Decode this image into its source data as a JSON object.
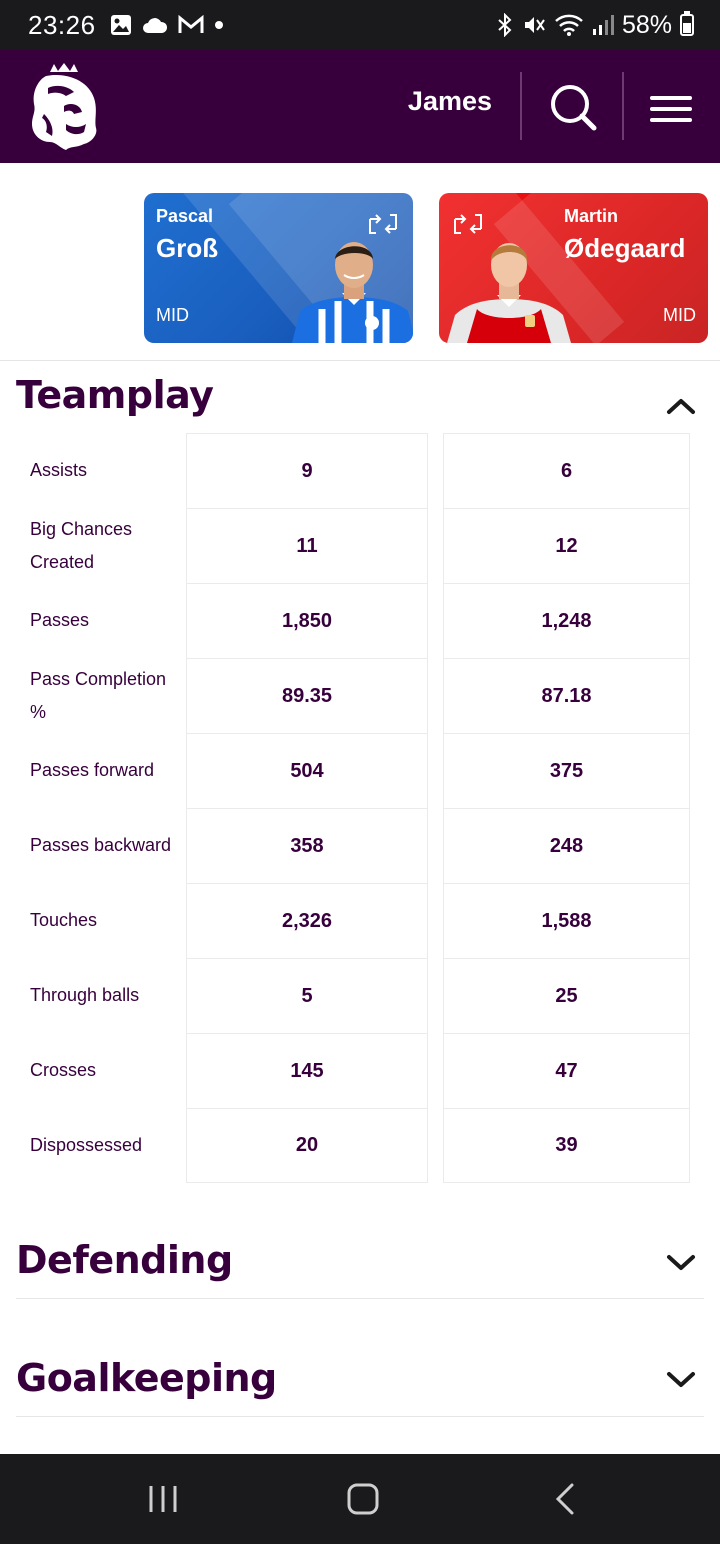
{
  "status_bar": {
    "time": "23:26",
    "battery": "58%",
    "battery_level": 0.58
  },
  "header": {
    "username": "James"
  },
  "players": [
    {
      "first_name": "Pascal",
      "last_name": "Groß",
      "position": "MID",
      "team_color": "#1a5fbf"
    },
    {
      "first_name": "Martin",
      "last_name": "Ødegaard",
      "position": "MID",
      "team_color": "#db0007"
    }
  ],
  "sections": {
    "teamplay": "Teamplay",
    "defending": "Defending",
    "goalkeeping": "Goalkeeping"
  },
  "teamplay_rows": [
    {
      "label": "Assists",
      "a": "9",
      "b": "6"
    },
    {
      "label": "Big Chances Created",
      "a": "11",
      "b": "12"
    },
    {
      "label": "Passes",
      "a": "1,850",
      "b": "1,248"
    },
    {
      "label": "Pass Completion %",
      "a": "89.35",
      "b": "87.18"
    },
    {
      "label": "Passes forward",
      "a": "504",
      "b": "375"
    },
    {
      "label": "Passes backward",
      "a": "358",
      "b": "248"
    },
    {
      "label": "Touches",
      "a": "2,326",
      "b": "1,588"
    },
    {
      "label": "Through balls",
      "a": "5",
      "b": "25"
    },
    {
      "label": "Crosses",
      "a": "145",
      "b": "47"
    },
    {
      "label": "Dispossessed",
      "a": "20",
      "b": "39"
    }
  ],
  "colors": {
    "brand_purple": "#37003c",
    "status_bar": "#1a1a1c"
  }
}
